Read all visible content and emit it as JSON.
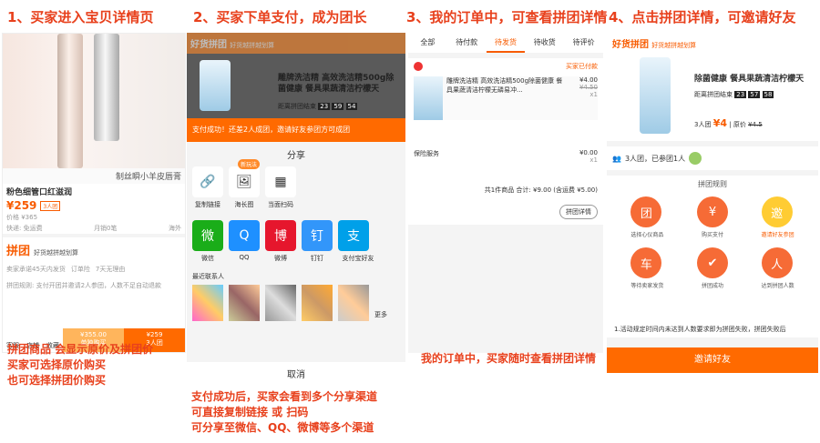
{
  "steps": [
    "1、买家进入宝贝详情页",
    "2、买家下单支付，成为团长",
    "3、我的订单中，可查看拼团详情",
    "4、点击拼团详情，可邀请好友"
  ],
  "captions": {
    "c1": [
      "拼团商品 会显示原价及拼团价",
      "买家可选择原价购买",
      "也可选择拼团价购买"
    ],
    "c2": [
      "支付成功后，买家会看到多个分享渠道",
      "可直接复制链接 或 扫码",
      "可分享至微信、QQ、微博等多个渠道"
    ],
    "c3": "我的订单中，买家随时查看拼团详情"
  },
  "p1": {
    "title": "制丝瞬小羊皮唇膏",
    "name": "粉色细管口红滋润",
    "price": "¥259",
    "badge": "3人团",
    "orig": "价格 ¥365",
    "ship": "快递: 免运费",
    "sold": "月销0笔",
    "loc": "海外",
    "pt": "拼团",
    "pt_sub": "好货越拼越划算",
    "guar": [
      "卖家承诺45天内发货",
      "订单险",
      "7天无理由"
    ],
    "rule": "拼团规则: 支付开团并邀请2人参团，人数不足自动退款",
    "tabs": [
      "客服",
      "店铺",
      "收藏"
    ],
    "buy_orig": "¥355.00",
    "buy_orig_lbl": "单独购买",
    "buy_pt": "¥259",
    "buy_pt_lbl": "3人团"
  },
  "p2": {
    "brand": "好货拼团",
    "brand_sub": "好货越拼越划算",
    "prod": "雕牌洗洁精 高效洗洁精500g除菌健康 餐具果蔬清洁柠檬天",
    "timer_lbl": "距离拼团结束",
    "timer": [
      "23",
      "59",
      "54"
    ],
    "banner": "支付成功！还差2人成团，邀请好友参团方可成团",
    "share": "分享",
    "new": "新玩法",
    "row1": [
      {
        "n": "复制链接",
        "g": "🔗"
      },
      {
        "n": "海长图",
        "g": "🖼"
      },
      {
        "n": "当面扫码",
        "g": "▦"
      }
    ],
    "row2": [
      {
        "n": "微信",
        "g": "微",
        "c": "#1aad19"
      },
      {
        "n": "QQ",
        "g": "Q",
        "c": "#1e90ff"
      },
      {
        "n": "微博",
        "g": "博",
        "c": "#e6162d"
      },
      {
        "n": "钉钉",
        "g": "钉",
        "c": "#3296fa"
      },
      {
        "n": "支付宝好友",
        "g": "支",
        "c": "#00a0e9"
      }
    ],
    "recent": "最近联系人",
    "more": "更多",
    "cancel": "取消"
  },
  "p3": {
    "tabs": [
      "全部",
      "待付款",
      "待发货",
      "待收货",
      "待评价"
    ],
    "status": "买家已付款",
    "prod": "雕牌洗洁精 高效洗洁精500g除菌健康 餐具果蔬清洁柠檬无磷易冲...",
    "price": "¥4.00",
    "orig": "¥4.50",
    "qty": "x1",
    "ins": "保险服务",
    "ins_price": "¥0.00",
    "ins_qty": "x1",
    "total": "共1件商品 合计: ¥9.00 (含运费 ¥5.00)",
    "btn": "拼团详情"
  },
  "p4": {
    "brand": "好货拼团",
    "brand_sub": "好货越拼越划算",
    "prod": "除菌健康 餐具果蔬清洁柠檬天",
    "timer_lbl": "距离拼团结束",
    "timer": [
      "23",
      "57",
      "58"
    ],
    "group": "3人团",
    "price": "¥4",
    "orig_lbl": "原价",
    "orig": "¥4.5",
    "joined": "3人团，已参团1人",
    "rules": "拼团规则",
    "r1": [
      {
        "n": "选择心仪商品",
        "g": "团"
      },
      {
        "n": "购买支付",
        "g": "¥"
      },
      {
        "n": "邀请好友参团",
        "g": "邀",
        "y": true
      }
    ],
    "r2": [
      {
        "n": "等待卖家发货",
        "g": "车"
      },
      {
        "n": "拼团成功",
        "g": "✔"
      },
      {
        "n": "达到拼团人数",
        "g": "人"
      }
    ],
    "note": "1.活动规定时间内未达到人数要求即为拼团失败，拼团失败后",
    "invite": "邀请好友"
  }
}
